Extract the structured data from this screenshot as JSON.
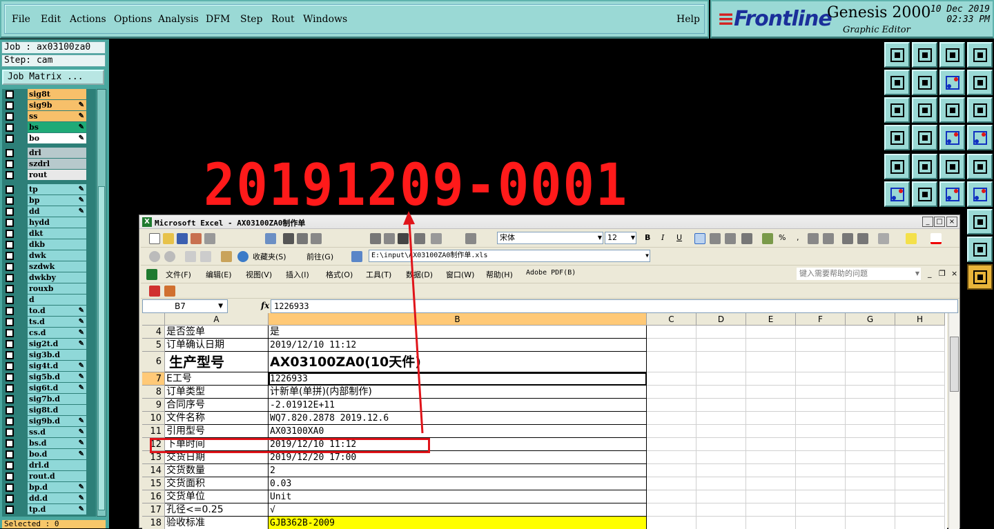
{
  "menubar": {
    "items": [
      "File",
      "Edit",
      "Actions",
      "Options",
      "Analysis",
      "DFM",
      "Step",
      "Rout",
      "Windows"
    ],
    "help": "Help"
  },
  "brand": {
    "logo": "Frontline",
    "product": "Genesis 2000",
    "subtitle": "Graphic Editor",
    "date": "10 Dec 2019",
    "time": "02:33 PM"
  },
  "job": {
    "job_line": "Job : ax03100za0",
    "step_line": "Step: cam",
    "matrix_button": "Job Matrix ...",
    "selected": "Selected : 0"
  },
  "layers": [
    {
      "name": "sig8t",
      "color": "#f7c06a",
      "pen": false
    },
    {
      "name": "sig9b",
      "color": "#f7c06a",
      "pen": true
    },
    {
      "name": "ss",
      "color": "#f7c06a",
      "pen": true
    },
    {
      "name": "bs",
      "color": "#1faa77",
      "pen": true
    },
    {
      "name": "bo",
      "color": "#ffffff",
      "pen": true
    },
    {
      "name": "drl",
      "color": "#b7c9cc",
      "pen": false,
      "gap": true
    },
    {
      "name": "szdrl",
      "color": "#b7c9cc",
      "pen": false
    },
    {
      "name": "rout",
      "color": "#e8e8e8",
      "pen": false
    },
    {
      "name": "tp",
      "color": "#8fd8d8",
      "pen": true,
      "gap": true
    },
    {
      "name": "bp",
      "color": "#8fd8d8",
      "pen": true
    },
    {
      "name": "dd",
      "color": "#8fd8d8",
      "pen": true
    },
    {
      "name": "hydd",
      "color": "#8fd8d8",
      "pen": false
    },
    {
      "name": "dkt",
      "color": "#8fd8d8",
      "pen": false
    },
    {
      "name": "dkb",
      "color": "#8fd8d8",
      "pen": false
    },
    {
      "name": "dwk",
      "color": "#8fd8d8",
      "pen": false
    },
    {
      "name": "szdwk",
      "color": "#8fd8d8",
      "pen": false
    },
    {
      "name": "dwkby",
      "color": "#8fd8d8",
      "pen": false
    },
    {
      "name": "rouxb",
      "color": "#8fd8d8",
      "pen": false
    },
    {
      "name": "d",
      "color": "#8fd8d8",
      "pen": false
    },
    {
      "name": "to.d",
      "color": "#8fd8d8",
      "pen": true
    },
    {
      "name": "ts.d",
      "color": "#8fd8d8",
      "pen": true
    },
    {
      "name": "cs.d",
      "color": "#8fd8d8",
      "pen": true
    },
    {
      "name": "sig2t.d",
      "color": "#8fd8d8",
      "pen": true
    },
    {
      "name": "sig3b.d",
      "color": "#8fd8d8",
      "pen": false
    },
    {
      "name": "sig4t.d",
      "color": "#8fd8d8",
      "pen": true
    },
    {
      "name": "sig5b.d",
      "color": "#8fd8d8",
      "pen": true
    },
    {
      "name": "sig6t.d",
      "color": "#8fd8d8",
      "pen": true
    },
    {
      "name": "sig7b.d",
      "color": "#8fd8d8",
      "pen": false
    },
    {
      "name": "sig8t.d",
      "color": "#8fd8d8",
      "pen": false
    },
    {
      "name": "sig9b.d",
      "color": "#8fd8d8",
      "pen": true
    },
    {
      "name": "ss.d",
      "color": "#8fd8d8",
      "pen": true
    },
    {
      "name": "bs.d",
      "color": "#8fd8d8",
      "pen": true
    },
    {
      "name": "bo.d",
      "color": "#8fd8d8",
      "pen": true
    },
    {
      "name": "drl.d",
      "color": "#8fd8d8",
      "pen": false
    },
    {
      "name": "rout.d",
      "color": "#8fd8d8",
      "pen": false
    },
    {
      "name": "bp.d",
      "color": "#8fd8d8",
      "pen": true
    },
    {
      "name": "dd.d",
      "color": "#8fd8d8",
      "pen": true
    },
    {
      "name": "tp.d",
      "color": "#8fd8d8",
      "pen": true
    }
  ],
  "canvas": {
    "annotation": "20191209-0001"
  },
  "excel": {
    "title": "Microsoft Excel - AX03100ZA0制作单",
    "font_name": "宋体",
    "font_size": "12",
    "address": "E:\\input\\AX03100ZA0制作单.xls",
    "favorites": "收藏夹(S)",
    "goto": "前往(G)",
    "help_placeholder": "键入需要帮助的问题",
    "menu": [
      "文件(F)",
      "编辑(E)",
      "视图(V)",
      "插入(I)",
      "格式(O)",
      "工具(T)",
      "数据(D)",
      "窗口(W)",
      "帮助(H)",
      "Adobe PDF(B)"
    ],
    "name_box": "B7",
    "fx": "fx",
    "formula": "1226933",
    "col_headers": [
      "A",
      "B",
      "C",
      "D",
      "E",
      "F",
      "G",
      "H"
    ],
    "rows": [
      {
        "num": "4",
        "a": "是否签单",
        "b": "是"
      },
      {
        "num": "5",
        "a": "订单确认日期",
        "b": "2019/12/10 11:12"
      },
      {
        "num": "6",
        "a": "生产型号",
        "b": "AX03100ZA0(10天件)",
        "big": true
      },
      {
        "num": "7",
        "a": "E工号",
        "b": "1226933",
        "active": true
      },
      {
        "num": "8",
        "a": "订单类型",
        "b": "计新单(单拼)(内部制作)"
      },
      {
        "num": "9",
        "a": "合同序号",
        "b": "-2.01912E+11"
      },
      {
        "num": "10",
        "a": "文件名称",
        "b": "WQ7.820.2878 2019.12.6"
      },
      {
        "num": "11",
        "a": "引用型号",
        "b": "AX03100XA0"
      },
      {
        "num": "12",
        "a": "下单时间",
        "b": "2019/12/10 11:12"
      },
      {
        "num": "13",
        "a": "交货日期",
        "b": "2019/12/20 17:00"
      },
      {
        "num": "14",
        "a": "交货数量",
        "b": "2"
      },
      {
        "num": "15",
        "a": "交货面积",
        "b": "0.03"
      },
      {
        "num": "16",
        "a": "交货单位",
        "b": "Unit"
      },
      {
        "num": "17",
        "a": "孔径<=0.25",
        "b": "√"
      },
      {
        "num": "18",
        "a": "验收标准",
        "b": "GJB362B-2009",
        "yellow": true
      }
    ]
  },
  "colors": {
    "genesis_teal": "#9ad9d5",
    "annotation_red": "#ff1a1a",
    "highlight_yellow": "#ffff00"
  }
}
